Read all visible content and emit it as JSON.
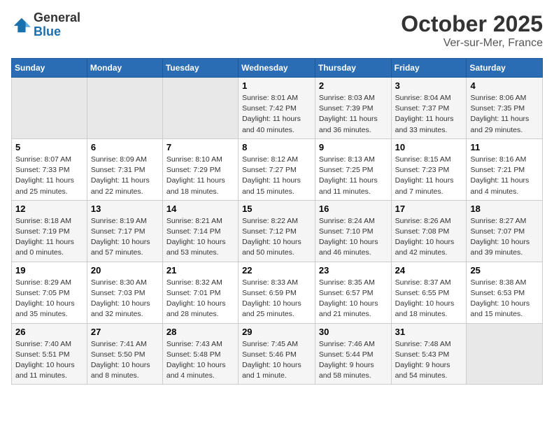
{
  "header": {
    "logo_general": "General",
    "logo_blue": "Blue",
    "month_title": "October 2025",
    "location": "Ver-sur-Mer, France"
  },
  "days_of_week": [
    "Sunday",
    "Monday",
    "Tuesday",
    "Wednesday",
    "Thursday",
    "Friday",
    "Saturday"
  ],
  "weeks": [
    [
      {
        "day": "",
        "info": ""
      },
      {
        "day": "",
        "info": ""
      },
      {
        "day": "",
        "info": ""
      },
      {
        "day": "1",
        "info": "Sunrise: 8:01 AM\nSunset: 7:42 PM\nDaylight: 11 hours\nand 40 minutes."
      },
      {
        "day": "2",
        "info": "Sunrise: 8:03 AM\nSunset: 7:39 PM\nDaylight: 11 hours\nand 36 minutes."
      },
      {
        "day": "3",
        "info": "Sunrise: 8:04 AM\nSunset: 7:37 PM\nDaylight: 11 hours\nand 33 minutes."
      },
      {
        "day": "4",
        "info": "Sunrise: 8:06 AM\nSunset: 7:35 PM\nDaylight: 11 hours\nand 29 minutes."
      }
    ],
    [
      {
        "day": "5",
        "info": "Sunrise: 8:07 AM\nSunset: 7:33 PM\nDaylight: 11 hours\nand 25 minutes."
      },
      {
        "day": "6",
        "info": "Sunrise: 8:09 AM\nSunset: 7:31 PM\nDaylight: 11 hours\nand 22 minutes."
      },
      {
        "day": "7",
        "info": "Sunrise: 8:10 AM\nSunset: 7:29 PM\nDaylight: 11 hours\nand 18 minutes."
      },
      {
        "day": "8",
        "info": "Sunrise: 8:12 AM\nSunset: 7:27 PM\nDaylight: 11 hours\nand 15 minutes."
      },
      {
        "day": "9",
        "info": "Sunrise: 8:13 AM\nSunset: 7:25 PM\nDaylight: 11 hours\nand 11 minutes."
      },
      {
        "day": "10",
        "info": "Sunrise: 8:15 AM\nSunset: 7:23 PM\nDaylight: 11 hours\nand 7 minutes."
      },
      {
        "day": "11",
        "info": "Sunrise: 8:16 AM\nSunset: 7:21 PM\nDaylight: 11 hours\nand 4 minutes."
      }
    ],
    [
      {
        "day": "12",
        "info": "Sunrise: 8:18 AM\nSunset: 7:19 PM\nDaylight: 11 hours\nand 0 minutes."
      },
      {
        "day": "13",
        "info": "Sunrise: 8:19 AM\nSunset: 7:17 PM\nDaylight: 10 hours\nand 57 minutes."
      },
      {
        "day": "14",
        "info": "Sunrise: 8:21 AM\nSunset: 7:14 PM\nDaylight: 10 hours\nand 53 minutes."
      },
      {
        "day": "15",
        "info": "Sunrise: 8:22 AM\nSunset: 7:12 PM\nDaylight: 10 hours\nand 50 minutes."
      },
      {
        "day": "16",
        "info": "Sunrise: 8:24 AM\nSunset: 7:10 PM\nDaylight: 10 hours\nand 46 minutes."
      },
      {
        "day": "17",
        "info": "Sunrise: 8:26 AM\nSunset: 7:08 PM\nDaylight: 10 hours\nand 42 minutes."
      },
      {
        "day": "18",
        "info": "Sunrise: 8:27 AM\nSunset: 7:07 PM\nDaylight: 10 hours\nand 39 minutes."
      }
    ],
    [
      {
        "day": "19",
        "info": "Sunrise: 8:29 AM\nSunset: 7:05 PM\nDaylight: 10 hours\nand 35 minutes."
      },
      {
        "day": "20",
        "info": "Sunrise: 8:30 AM\nSunset: 7:03 PM\nDaylight: 10 hours\nand 32 minutes."
      },
      {
        "day": "21",
        "info": "Sunrise: 8:32 AM\nSunset: 7:01 PM\nDaylight: 10 hours\nand 28 minutes."
      },
      {
        "day": "22",
        "info": "Sunrise: 8:33 AM\nSunset: 6:59 PM\nDaylight: 10 hours\nand 25 minutes."
      },
      {
        "day": "23",
        "info": "Sunrise: 8:35 AM\nSunset: 6:57 PM\nDaylight: 10 hours\nand 21 minutes."
      },
      {
        "day": "24",
        "info": "Sunrise: 8:37 AM\nSunset: 6:55 PM\nDaylight: 10 hours\nand 18 minutes."
      },
      {
        "day": "25",
        "info": "Sunrise: 8:38 AM\nSunset: 6:53 PM\nDaylight: 10 hours\nand 15 minutes."
      }
    ],
    [
      {
        "day": "26",
        "info": "Sunrise: 7:40 AM\nSunset: 5:51 PM\nDaylight: 10 hours\nand 11 minutes."
      },
      {
        "day": "27",
        "info": "Sunrise: 7:41 AM\nSunset: 5:50 PM\nDaylight: 10 hours\nand 8 minutes."
      },
      {
        "day": "28",
        "info": "Sunrise: 7:43 AM\nSunset: 5:48 PM\nDaylight: 10 hours\nand 4 minutes."
      },
      {
        "day": "29",
        "info": "Sunrise: 7:45 AM\nSunset: 5:46 PM\nDaylight: 10 hours\nand 1 minute."
      },
      {
        "day": "30",
        "info": "Sunrise: 7:46 AM\nSunset: 5:44 PM\nDaylight: 9 hours\nand 58 minutes."
      },
      {
        "day": "31",
        "info": "Sunrise: 7:48 AM\nSunset: 5:43 PM\nDaylight: 9 hours\nand 54 minutes."
      },
      {
        "day": "",
        "info": ""
      }
    ]
  ]
}
